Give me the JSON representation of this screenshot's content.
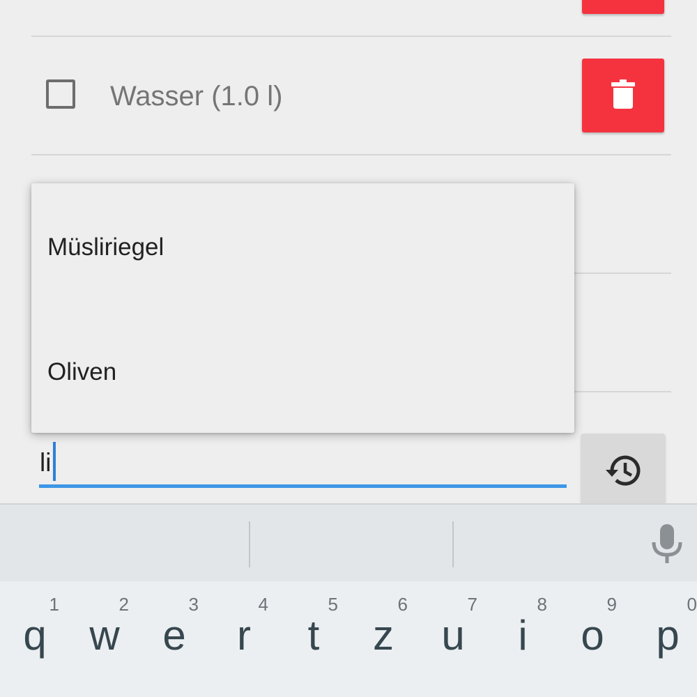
{
  "list": {
    "items": [
      {
        "label": "Wasser (1.0 l)",
        "checked": false
      }
    ]
  },
  "icons": {
    "delete": "trash-icon",
    "history": "history-icon",
    "mic": "microphone-icon"
  },
  "autocomplete": {
    "suggestions": [
      "Müsliriegel",
      "Oliven"
    ]
  },
  "input": {
    "value": "li"
  },
  "keyboard": {
    "row1": [
      {
        "letter": "q",
        "num": "1"
      },
      {
        "letter": "w",
        "num": "2"
      },
      {
        "letter": "e",
        "num": "3"
      },
      {
        "letter": "r",
        "num": "4"
      },
      {
        "letter": "t",
        "num": "5"
      },
      {
        "letter": "z",
        "num": "6"
      },
      {
        "letter": "u",
        "num": "7"
      },
      {
        "letter": "i",
        "num": "8"
      },
      {
        "letter": "o",
        "num": "9"
      },
      {
        "letter": "p",
        "num": "0"
      }
    ]
  },
  "colors": {
    "delete": "#f5333f",
    "accent": "#3d96e6"
  }
}
